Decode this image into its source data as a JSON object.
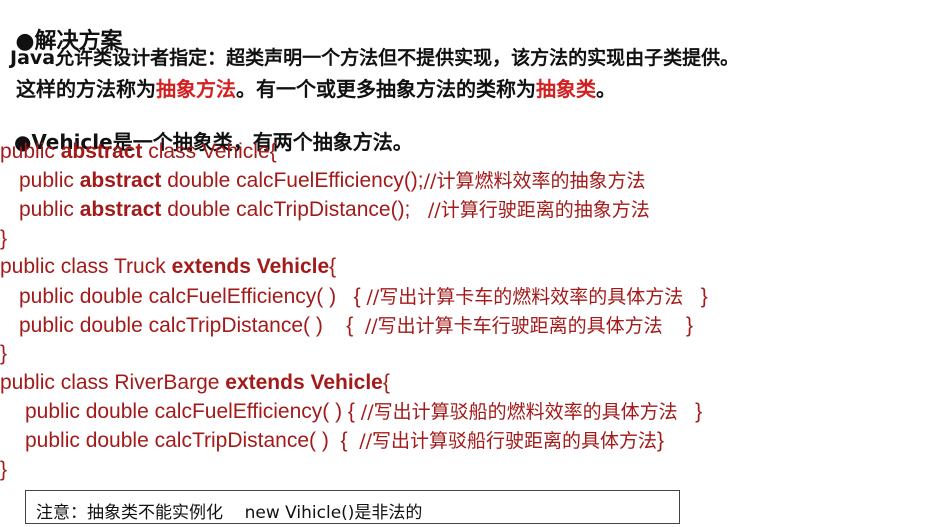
{
  "heading": {
    "bullet": "●",
    "title": "解决方案"
  },
  "paragraph1": {
    "line1": "Java允许类设计者指定：超类声明一个方法但不提供实现，该方法的实现由子类提供。",
    "line2_a": "这样的方法称为",
    "line2_b": "抽象方法",
    "line2_c": "。有一个或更多抽象方法的类称为",
    "line2_d": "抽象类",
    "line2_e": "。"
  },
  "paragraph2": {
    "bullet": "●",
    "bold": "Vehicle",
    "text": "是一个抽象类，有两个抽象方法。"
  },
  "code": {
    "vehicle": {
      "decl_a": "public ",
      "decl_kw": "abstract",
      "decl_b": " class Vehicle{",
      "m1_a": "public ",
      "m1_kw": "abstract",
      "m1_b": " double calcFuelEfficiency();",
      "m1_comment": "//计算燃料效率的抽象方法",
      "m2_a": "public ",
      "m2_kw": "abstract",
      "m2_b": " double calcTripDistance();   ",
      "m2_comment": "//计算行驶距离的抽象方法",
      "close": "}"
    },
    "truck": {
      "decl_a": "public class Truck ",
      "decl_kw": "extends Vehicle",
      "decl_b": "{",
      "m1": "public double calcFuelEfficiency( )   { ",
      "m1_comment": "//写出计算卡车的燃料效率的具体方法",
      "m1_end": "   }",
      "m2": "public double calcTripDistance( )    {  ",
      "m2_comment": "//写出计算卡车行驶距离的具体方法",
      "m2_end": "    }",
      "close": "}"
    },
    "riverbarge": {
      "decl_a": "public class RiverBarge ",
      "decl_kw": "extends Vehicle",
      "decl_b": "{",
      "m1": "public double calcFuelEfficiency( ) { ",
      "m1_comment": "//写出计算驳船的燃料效率的具体方法",
      "m1_end": "   }",
      "m2": "public double calcTripDistance( )  {  ",
      "m2_comment": "//写出计算驳船行驶距离的具体方法",
      "m2_end": "}",
      "close": "}"
    }
  },
  "note": "注意：抽象类不能实例化    new Vihicle()是非法的",
  "colors": {
    "highlight": "#d42020",
    "code": "#a31a1a",
    "text": "#111111"
  }
}
